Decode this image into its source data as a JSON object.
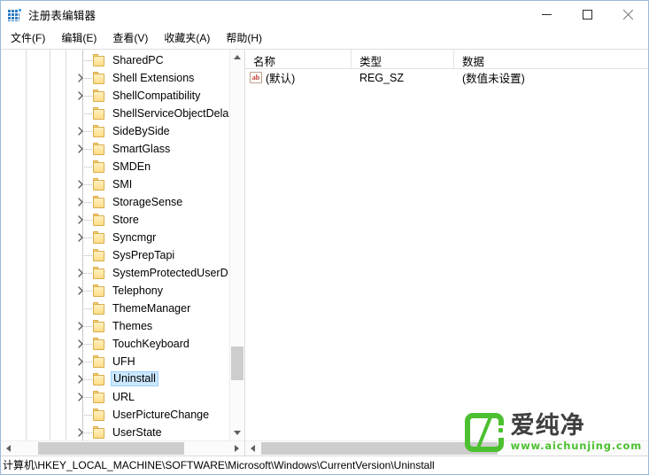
{
  "window": {
    "title": "注册表编辑器",
    "icon": "registry-icon",
    "caption_buttons": [
      {
        "name": "minimize",
        "glyph": "minimize-icon"
      },
      {
        "name": "maximize",
        "glyph": "maximize-icon"
      },
      {
        "name": "close",
        "glyph": "close-icon"
      }
    ]
  },
  "menubar": {
    "items": [
      {
        "label": "文件(F)",
        "name": "menu-file"
      },
      {
        "label": "编辑(E)",
        "name": "menu-edit"
      },
      {
        "label": "查看(V)",
        "name": "menu-view"
      },
      {
        "label": "收藏夹(A)",
        "name": "menu-favorites"
      },
      {
        "label": "帮助(H)",
        "name": "menu-help"
      }
    ]
  },
  "tree": {
    "items": [
      {
        "label": "SharedPC",
        "expandable": false,
        "selected": false
      },
      {
        "label": "Shell Extensions",
        "expandable": true,
        "selected": false
      },
      {
        "label": "ShellCompatibility",
        "expandable": true,
        "selected": false
      },
      {
        "label": "ShellServiceObjectDela",
        "expandable": false,
        "selected": false
      },
      {
        "label": "SideBySide",
        "expandable": true,
        "selected": false
      },
      {
        "label": "SmartGlass",
        "expandable": true,
        "selected": false
      },
      {
        "label": "SMDEn",
        "expandable": false,
        "selected": false
      },
      {
        "label": "SMI",
        "expandable": true,
        "selected": false
      },
      {
        "label": "StorageSense",
        "expandable": true,
        "selected": false
      },
      {
        "label": "Store",
        "expandable": true,
        "selected": false
      },
      {
        "label": "Syncmgr",
        "expandable": true,
        "selected": false
      },
      {
        "label": "SysPrepTapi",
        "expandable": false,
        "selected": false
      },
      {
        "label": "SystemProtectedUserD",
        "expandable": true,
        "selected": false
      },
      {
        "label": "Telephony",
        "expandable": true,
        "selected": false
      },
      {
        "label": "ThemeManager",
        "expandable": false,
        "selected": false
      },
      {
        "label": "Themes",
        "expandable": true,
        "selected": false
      },
      {
        "label": "TouchKeyboard",
        "expandable": true,
        "selected": false
      },
      {
        "label": "UFH",
        "expandable": true,
        "selected": false
      },
      {
        "label": "Uninstall",
        "expandable": true,
        "selected": true
      },
      {
        "label": "URL",
        "expandable": true,
        "selected": false
      },
      {
        "label": "UserPictureChange",
        "expandable": false,
        "selected": false
      },
      {
        "label": "UserState",
        "expandable": true,
        "selected": false
      }
    ]
  },
  "list": {
    "columns": [
      {
        "label": "名称",
        "name": "column-name"
      },
      {
        "label": "类型",
        "name": "column-type"
      },
      {
        "label": "数据",
        "name": "column-data"
      }
    ],
    "rows": [
      {
        "icon": "string-value-icon",
        "name": "(默认)",
        "type": "REG_SZ",
        "data": "(数值未设置)"
      }
    ]
  },
  "statusbar": {
    "path": "计算机\\HKEY_LOCAL_MACHINE\\SOFTWARE\\Microsoft\\Windows\\CurrentVersion\\Uninstall"
  },
  "watermark": {
    "brand": "爱纯净",
    "url": "www.aichunjing.com",
    "color": "#4cc030"
  }
}
